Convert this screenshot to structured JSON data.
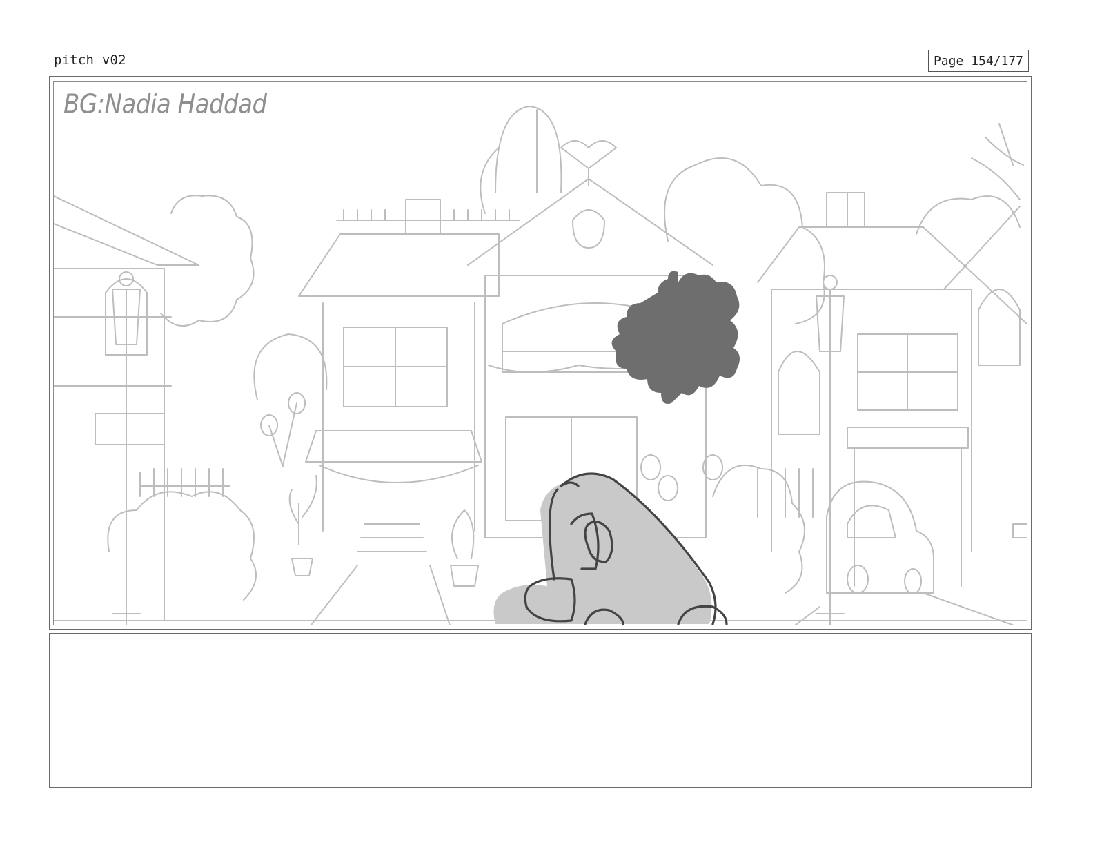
{
  "header": {
    "title": "pitch v02",
    "page_label": "Page 154/177"
  },
  "panel": {
    "bg_credit": "BG:Nadia Haddad"
  },
  "notes": {
    "text": ""
  },
  "colors": {
    "sketch_line": "#b9b9b9",
    "character_dark": "#6e6e6e",
    "foreground_fill": "#c9c9c9",
    "foreground_line": "#444444"
  }
}
